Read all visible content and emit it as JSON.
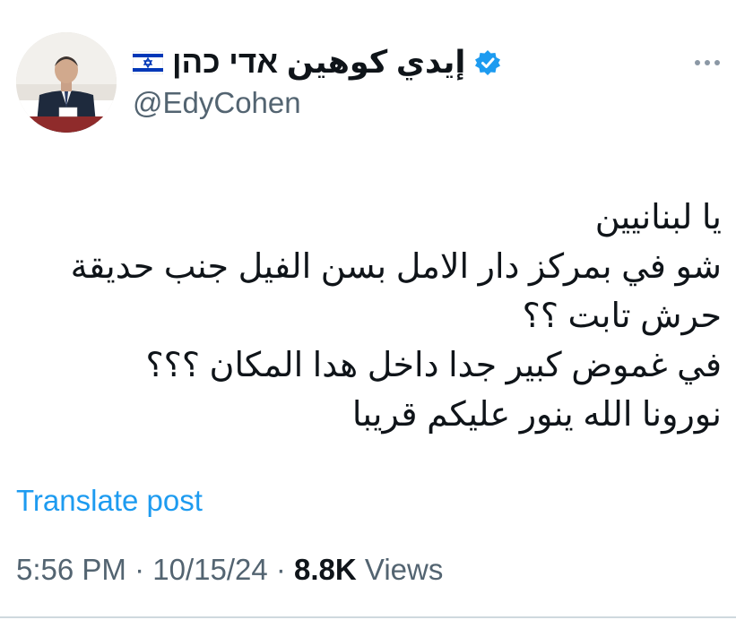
{
  "author": {
    "display_name": "إيدي كوهين אדי כהן",
    "handle": "@EdyCohen",
    "flag_icon": "israel-flag-icon",
    "verified_icon": "verified-badge-icon"
  },
  "tweet": {
    "lines": [
      "يا لبنانيين",
      "شو في بمركز دار الامل بسن الفيل جنب حديقة",
      "حرش تابت ؟؟",
      "في غموض كبير جدا داخل هدا المكان ؟؟؟",
      "نورونا الله ينور عليكم قريبا"
    ]
  },
  "translate_label": "Translate post",
  "meta": {
    "time": "5:56 PM",
    "separator": " · ",
    "date": "10/15/24",
    "views_count": "8.8K",
    "views_label": " Views"
  },
  "colors": {
    "accent": "#1d9bf0",
    "secondary_text": "#536471",
    "primary_text": "#0f1419",
    "verified": "#1d9bf0"
  }
}
